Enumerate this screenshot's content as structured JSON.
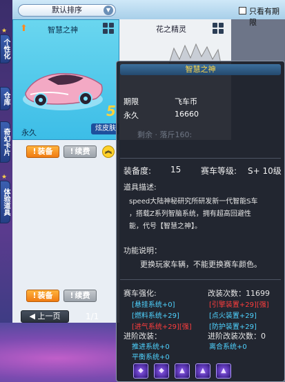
{
  "top_bar": {
    "sort_label": "默认排序",
    "only_label": "只看有期限"
  },
  "side_tabs": [
    {
      "label": "个性化"
    },
    {
      "label": "仓库"
    },
    {
      "label": "奇幻卡片"
    },
    {
      "label": "体验道具"
    }
  ],
  "card": {
    "title": "智慧之神",
    "tier": "5",
    "duration": "永久",
    "skin_tag": "炫皮肤"
  },
  "card2": {
    "title": "花之精灵"
  },
  "buttons": {
    "equip": "装备",
    "renew": "续费",
    "exclaim": "!"
  },
  "pager": {
    "prev": "上一页",
    "page": "1/1"
  },
  "tooltip": {
    "title": "智慧之神",
    "col_term": "期限",
    "col_currency": "飞车币",
    "term_value": "永久",
    "price_value": "16660",
    "faint_text": "剩余 · 落斤160:",
    "equip_label": "装备度:",
    "equip_value": "15",
    "level_label": "赛车等级:",
    "level_value": "S+ 10级",
    "desc_title": "道具描述:",
    "desc_line1": "speed大陆神秘研究所研发新一代智能S车",
    "desc_line2": "，搭载Z系列智脑系统，拥有超高回避性",
    "desc_line3": "能，代号【智慧之神】。",
    "func_title": "功能说明：",
    "func_line": "更换玩家车辆，不能更换赛车颜色。",
    "strength_title": "赛车强化:",
    "mod_count": "改装次数：11699",
    "sys": [
      {
        "text": "[悬挂系统+0]",
        "color": "cyan"
      },
      {
        "text": "[引擎装置+29][强]",
        "color": "red"
      },
      {
        "text": "[燃料系统+29]",
        "color": "cyan"
      },
      {
        "text": "[点火装置+29]",
        "color": "cyan"
      },
      {
        "text": "[进气系统+29][强]",
        "color": "red"
      },
      {
        "text": "[防护装置+29]",
        "color": "cyan"
      }
    ],
    "adv_title": "进阶改装：",
    "adv_count": "进阶改装次数：0",
    "adv_items": [
      {
        "text": "推进系统+0"
      },
      {
        "text": "离合系统+0"
      },
      {
        "text": "平衡系统+0"
      }
    ],
    "gems": [
      "◆",
      "◆",
      "▲",
      "▲",
      "▲"
    ]
  }
}
